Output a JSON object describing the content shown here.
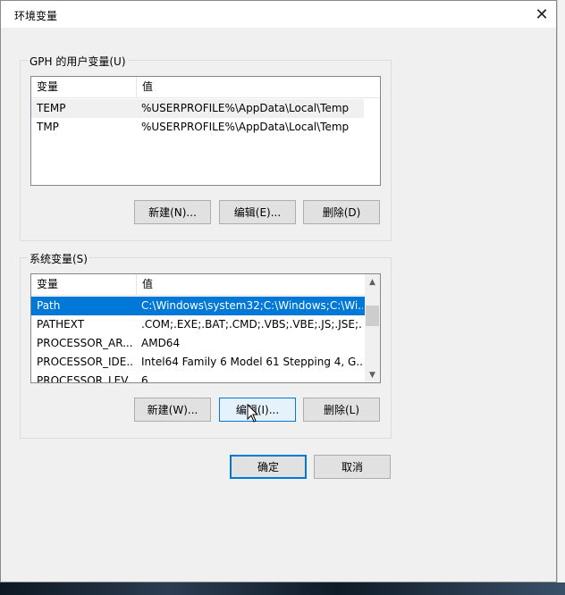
{
  "window": {
    "title": "环境变量"
  },
  "user_group": {
    "legend": "GPH 的用户变量(U)",
    "columns": [
      "变量",
      "值"
    ],
    "rows": [
      {
        "name": "TEMP",
        "value": "%USERPROFILE%\\AppData\\Local\\Temp"
      },
      {
        "name": "TMP",
        "value": "%USERPROFILE%\\AppData\\Local\\Temp"
      }
    ],
    "buttons": {
      "new": "新建(N)...",
      "edit": "编辑(E)...",
      "delete": "删除(D)"
    }
  },
  "system_group": {
    "legend": "系统变量(S)",
    "columns": [
      "变量",
      "值"
    ],
    "rows": [
      {
        "name": "Path",
        "value": "C:\\Windows\\system32;C:\\Windows;C:\\Wi..."
      },
      {
        "name": "PATHEXT",
        "value": ".COM;.EXE;.BAT;.CMD;.VBS;.VBE;.JS;.JSE;..."
      },
      {
        "name": "PROCESSOR_AR...",
        "value": "AMD64"
      },
      {
        "name": "PROCESSOR_IDE...",
        "value": "Intel64 Family 6 Model 61 Stepping 4, G..."
      },
      {
        "name": "PROCESSOR_LEV...",
        "value": "6"
      }
    ],
    "buttons": {
      "new": "新建(W)...",
      "edit": "编辑(I)...",
      "delete": "删除(L)"
    }
  },
  "footer": {
    "ok": "确定",
    "cancel": "取消"
  },
  "colors": {
    "selection": "#0078d7",
    "default_border": "#0078d7"
  }
}
